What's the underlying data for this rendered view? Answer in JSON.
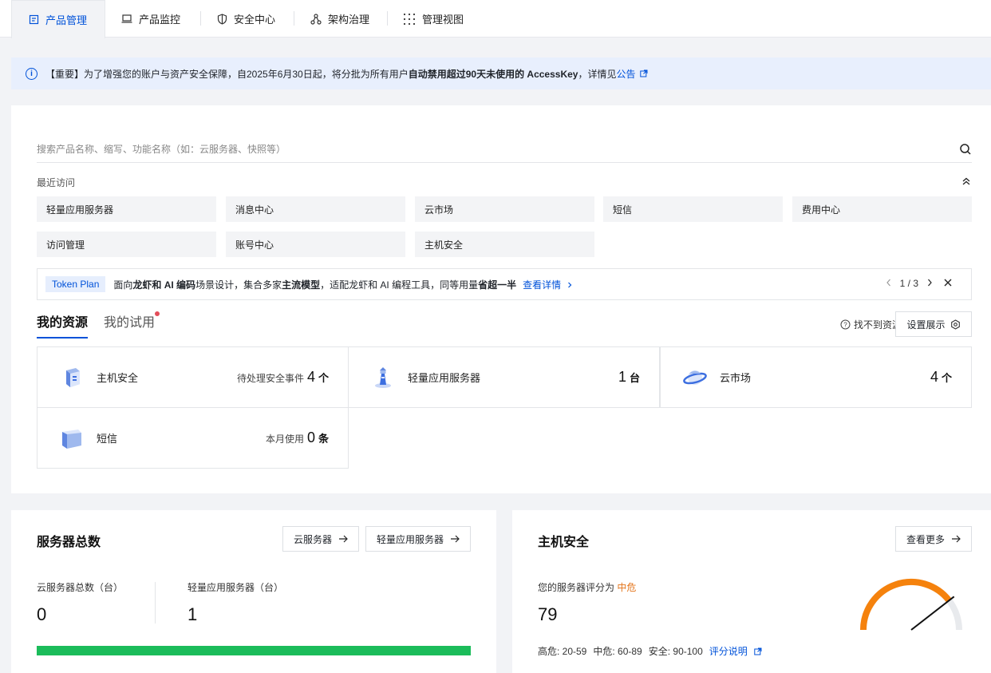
{
  "nav": {
    "tabs": [
      {
        "label": "产品管理",
        "icon": "document-icon"
      },
      {
        "label": "产品监控",
        "icon": "monitor-icon"
      },
      {
        "label": "安全中心",
        "icon": "shield-icon"
      },
      {
        "label": "架构治理",
        "icon": "architecture-icon"
      },
      {
        "label": "管理视图",
        "icon": "grid-dots-icon"
      }
    ]
  },
  "notice": {
    "prefix": "【重要】为了增强您的账户与资产安全保障，自2025年6月30日起，将分批为所有用户",
    "bold": "自动禁用超过90天未使用的 AccessKey",
    "suffix": "，详情见",
    "link": "公告"
  },
  "search": {
    "placeholder": "搜索产品名称、缩写、功能名称（如：云服务器、快照等）"
  },
  "recent": {
    "title": "最近访问",
    "items": [
      "轻量应用服务器",
      "消息中心",
      "云市场",
      "短信",
      "费用中心",
      "访问管理",
      "账号中心",
      "主机安全"
    ]
  },
  "promo": {
    "tag": "Token Plan",
    "t1": "面向",
    "b1": "龙虾和 AI 编码",
    "t2": "场景设计，集合多家",
    "b2": "主流模型",
    "t3": "，适配龙虾和 AI 编程工具，同等用量",
    "b3": "省超一半",
    "link": "查看详情",
    "page": "1 / 3"
  },
  "resources": {
    "tab_mine": "我的资源",
    "tab_trial": "我的试用",
    "not_found": "找不到资源",
    "settings": "设置展示",
    "cards": [
      {
        "name": "主机安全",
        "label": "待处理安全事件",
        "num": "4",
        "unit": "个"
      },
      {
        "name": "轻量应用服务器",
        "label": "",
        "num": "1",
        "unit": "台"
      },
      {
        "name": "云市场",
        "label": "",
        "num": "4",
        "unit": "个"
      },
      {
        "name": "短信",
        "label": "本月使用",
        "num": "0",
        "unit": "条"
      }
    ]
  },
  "servers": {
    "title": "服务器总数",
    "btn_cvm": "云服务器",
    "btn_lh": "轻量应用服务器",
    "cvm_label": "云服务器总数（台）",
    "cvm_value": "0",
    "lh_label": "轻量应用服务器（台）",
    "lh_value": "1",
    "bar_fill_fraction": 1.0,
    "bar_color": "#1bbc5a"
  },
  "host_security": {
    "title": "主机安全",
    "more": "查看更多",
    "score_label": "您的服务器评分为",
    "level": "中危",
    "score": "79",
    "legend_high": "高危: 20-59",
    "legend_mid": "中危: 60-89",
    "legend_safe": "安全: 90-100",
    "legend_link": "评分说明",
    "gauge_color": "#f5820d"
  },
  "colors": {
    "accent": "#0052d9",
    "notice_bg": "#e8effd",
    "warn": "#e37318",
    "success": "#1bbc5a"
  }
}
